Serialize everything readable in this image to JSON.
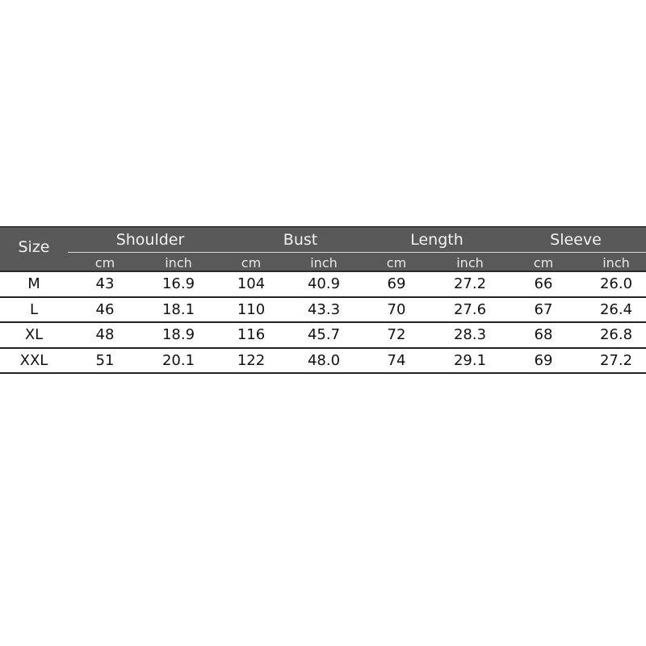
{
  "table": {
    "size_header": "Size",
    "groups": [
      "Shoulder",
      "Bust",
      "Length",
      "Sleeve"
    ],
    "units": [
      "cm",
      "inch",
      "cm",
      "inch",
      "cm",
      "inch",
      "cm",
      "inch"
    ],
    "rows": [
      {
        "size": "M",
        "values": [
          "43",
          "16.9",
          "104",
          "40.9",
          "69",
          "27.2",
          "66",
          "26.0"
        ]
      },
      {
        "size": "L",
        "values": [
          "46",
          "18.1",
          "110",
          "43.3",
          "70",
          "27.6",
          "67",
          "26.4"
        ]
      },
      {
        "size": "XL",
        "values": [
          "48",
          "18.9",
          "116",
          "45.7",
          "72",
          "28.3",
          "68",
          "26.8"
        ]
      },
      {
        "size": "XXL",
        "values": [
          "51",
          "20.1",
          "122",
          "48.0",
          "74",
          "29.1",
          "69",
          "27.2"
        ]
      }
    ]
  }
}
